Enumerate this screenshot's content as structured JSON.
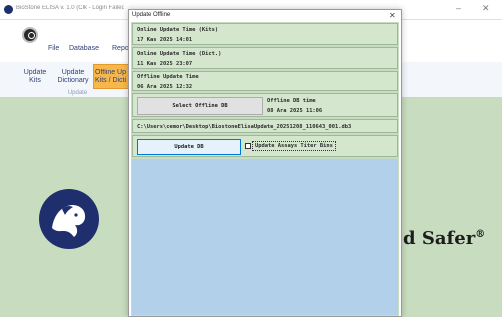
{
  "app": {
    "title": "BioStone ELISA v. 1.0 (Clk - Login Failed)",
    "menu": {
      "file": "File",
      "database": "Database",
      "reports": "Repo"
    },
    "ribbon": {
      "update_kits": "Update\nKits",
      "update_dictionary": "Update\nDictionary",
      "offline_update": "Offline Up\nKits / Dicti",
      "group_label": "Update"
    },
    "brand_text": "d Safer",
    "brand_symbol": "®"
  },
  "dialog": {
    "title": "Update Offline",
    "online_kits_label": "Online Update Time (Kits)",
    "online_kits_value": "17 Kas 2025 14:01",
    "online_dict_label": "Online Update Time (Dict.)",
    "online_dict_value": "11 Kas 2025 23:07",
    "offline_label": "Offline Update Time",
    "offline_value": "06 Ara 2025 12:32",
    "select_button": "Select Offline DB",
    "offline_db_time_label": "Offline DB time",
    "offline_db_time_value": "08 Ara 2025 11:06",
    "db_path": "C:\\Users\\cemor\\Desktop\\BiostoneElisaUpdate_20251208_110643_001.db3",
    "update_button": "Update DB",
    "checkbox_label": "Update Assays Titer Bins",
    "checkbox_checked": false
  },
  "colors": {
    "dialog_green": "#c7dcc1",
    "dialog_blue": "#b2d0ea",
    "accent_orange": "#f7b84b",
    "brand_navy": "#1f2f6e"
  }
}
